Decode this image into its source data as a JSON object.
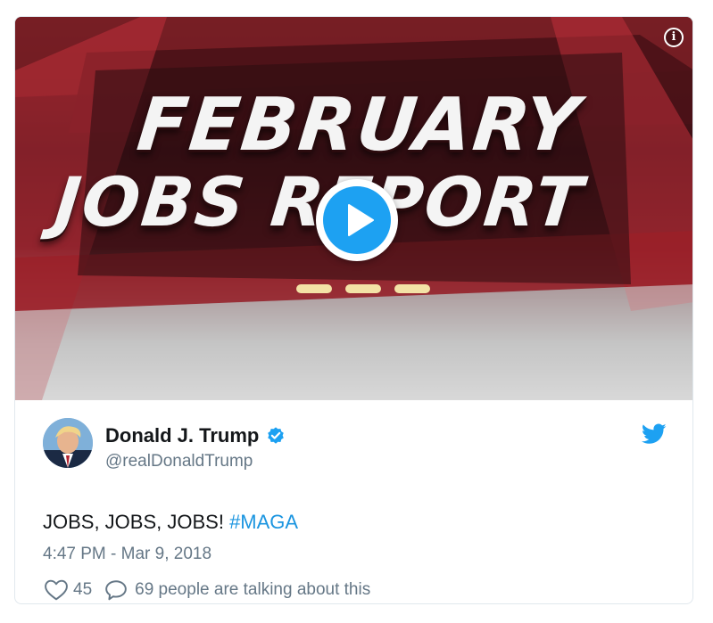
{
  "media": {
    "headline_line1": "FEBRUARY",
    "headline_line2": "JOBS REPORT",
    "info_glyph": "i",
    "accent_color": "#1da1f2"
  },
  "tweet": {
    "author_name": "Donald J. Trump",
    "author_handle": "@realDonaldTrump",
    "text": "JOBS, JOBS, JOBS! ",
    "hashtag": "#MAGA",
    "timestamp": "4:47 PM - Mar 9, 2018",
    "like_count": "45",
    "talking_text": "69 people are talking about this"
  },
  "icons": {
    "verified": "verified-badge-icon",
    "twitter": "twitter-bird-icon",
    "like": "heart-icon",
    "reply": "comment-bubble-icon",
    "play": "play-icon",
    "info": "info-icon"
  },
  "colors": {
    "name": "#14171a",
    "secondary": "#657786",
    "hashtag": "#1b95e0",
    "twitter_blue": "#1da1f2"
  }
}
